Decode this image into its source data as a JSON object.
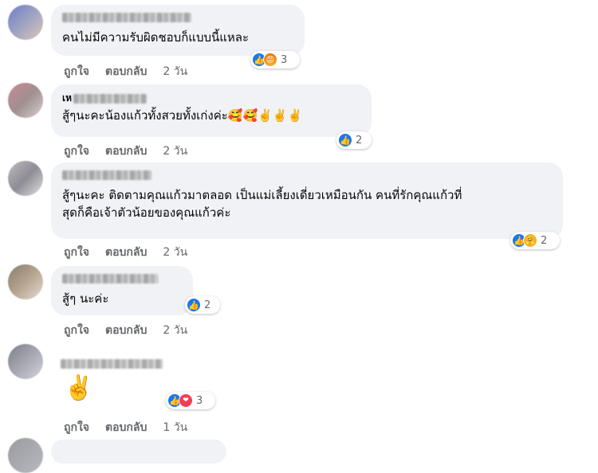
{
  "comments": [
    {
      "name_prefix": "",
      "text": "คนไม่มีความรับผิดชอบก็แบบนี้แหละ",
      "reactions": {
        "types": [
          "like-icon",
          "angry-icon"
        ],
        "count": "3"
      },
      "actions": {
        "like": "ถูกใจ",
        "reply": "ตอบกลับ",
        "time": "2 วัน"
      }
    },
    {
      "name_prefix": "เห",
      "text": "สู้ๆนะคะน้องแก้วทั้งสวยทั้งเก่งค่ะ🥰🥰✌️✌️✌️",
      "reactions": {
        "types": [
          "like-icon"
        ],
        "count": "2"
      },
      "actions": {
        "like": "ถูกใจ",
        "reply": "ตอบกลับ",
        "time": "2 วัน"
      }
    },
    {
      "name_prefix": "",
      "text": "สู้ๆนะคะ ติดตามคุณแก้วมาตลอด เป็นแม่เลี้ยงเดี่ยวเหมือนกัน คนที่รักคุณแก้วที่\nสุดก็คือเจ้าตัวน้อยของคุณแก้วค่ะ",
      "reactions": {
        "types": [
          "like-icon",
          "care-icon"
        ],
        "count": "2"
      },
      "actions": {
        "like": "ถูกใจ",
        "reply": "ตอบกลับ",
        "time": "2 วัน"
      }
    },
    {
      "name_prefix": "",
      "text": "สู้ๆ นะค่ะ",
      "reactions": {
        "types": [
          "like-icon"
        ],
        "count": "2"
      },
      "actions": {
        "like": "ถูกใจ",
        "reply": "ตอบกลับ",
        "time": "2 วัน"
      }
    },
    {
      "name_prefix": "",
      "text": "✌️",
      "reactions": {
        "types": [
          "like-icon",
          "love-icon"
        ],
        "count": "3"
      },
      "actions": {
        "like": "ถูกใจ",
        "reply": "ตอบกลับ",
        "time": "1 วัน"
      }
    }
  ],
  "colors": {
    "bubble": "#f0f2f5",
    "meta_text": "#65676b",
    "like_blue": "#1877f2",
    "love_red": "#f33e58",
    "care_yellow": "#f7b125"
  }
}
